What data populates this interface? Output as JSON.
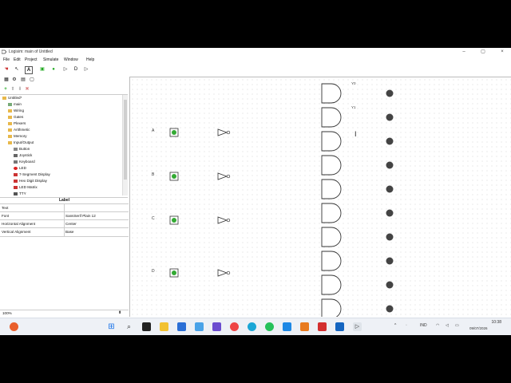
{
  "window": {
    "title": "Logisim: main of Untitled",
    "minimize": "–",
    "maximize": "▢",
    "close": "×"
  },
  "menu": [
    "File",
    "Edit",
    "Project",
    "Simulate",
    "Window",
    "Help"
  ],
  "explorer": {
    "items": [
      {
        "label": "Untitled*",
        "indent": 0,
        "icon": "folder-icon"
      },
      {
        "label": "main",
        "indent": 1,
        "icon": "circuit-icon"
      },
      {
        "label": "Wiring",
        "indent": 1,
        "icon": "folder-icon"
      },
      {
        "label": "Gates",
        "indent": 1,
        "icon": "folder-icon"
      },
      {
        "label": "Plexers",
        "indent": 1,
        "icon": "folder-icon"
      },
      {
        "label": "Arithmetic",
        "indent": 1,
        "icon": "folder-icon"
      },
      {
        "label": "Memory",
        "indent": 1,
        "icon": "folder-icon"
      },
      {
        "label": "Input/Output",
        "indent": 1,
        "icon": "folder-icon"
      },
      {
        "label": "Button",
        "indent": 2,
        "icon": "button-icon"
      },
      {
        "label": "Joystick",
        "indent": 2,
        "icon": "joystick-icon"
      },
      {
        "label": "Keyboard",
        "indent": 2,
        "icon": "keyboard-icon"
      },
      {
        "label": "LED",
        "indent": 2,
        "icon": "led-icon"
      },
      {
        "label": "7-Segment Display",
        "indent": 2,
        "icon": "seven-segment-icon"
      },
      {
        "label": "Hex Digit Display",
        "indent": 2,
        "icon": "hex-display-icon"
      },
      {
        "label": "LED Matrix",
        "indent": 2,
        "icon": "led-matrix-icon"
      },
      {
        "label": "TTY",
        "indent": 2,
        "icon": "tty-icon"
      }
    ]
  },
  "properties": {
    "title": "Label",
    "rows": [
      {
        "key": "Text",
        "value": ""
      },
      {
        "key": "Font",
        "value": "SansSerif Plain 12"
      },
      {
        "key": "Horizontal Alignment",
        "value": "Center"
      },
      {
        "key": "Vertical Alignment",
        "value": "Base"
      }
    ]
  },
  "zoom": "100%",
  "circuit": {
    "inputs": [
      "A",
      "B",
      "C",
      "D"
    ],
    "output_labels": [
      "Y0",
      "Y1"
    ],
    "gate_count": 10
  },
  "taskbar": {
    "lang": "IND",
    "time": "10:38",
    "date": "09/07/2026"
  }
}
